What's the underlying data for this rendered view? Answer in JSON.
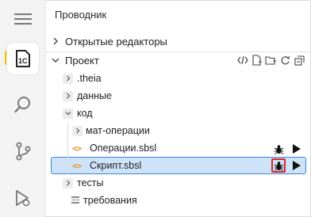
{
  "activity_bar": {
    "items": [
      {
        "icon": "hamburger-menu-icon"
      },
      {
        "icon": "explorer-1c-icon",
        "badge": "1C",
        "active": true
      },
      {
        "icon": "search-icon"
      },
      {
        "icon": "source-control-icon"
      },
      {
        "icon": "run-debug-icon"
      }
    ],
    "accent": "#f2c500"
  },
  "explorer": {
    "title": "Проводник",
    "open_editors_label": "Открытые редакторы",
    "project_label": "Проект",
    "toolbar": [
      "code-icon",
      "new-file-icon",
      "new-folder-icon",
      "refresh-icon",
      "collapse-all-icon"
    ],
    "tree": [
      {
        "label": ".theia",
        "type": "folder",
        "expanded": false
      },
      {
        "label": "данные",
        "type": "folder",
        "expanded": false
      },
      {
        "label": "код",
        "type": "folder",
        "expanded": true
      },
      {
        "label": "мат-операции",
        "type": "folder",
        "expanded": false
      },
      {
        "label": "Операции.sbsl",
        "type": "file",
        "icon": "<>"
      },
      {
        "label": "Скрипт.sbsl",
        "type": "file",
        "icon": "<>",
        "selected": true
      },
      {
        "label": "тесты",
        "type": "folder",
        "expanded": false
      },
      {
        "label": "требования",
        "type": "file"
      }
    ],
    "selection_color": "#cfe3f8",
    "highlight_color": "#d9262f"
  }
}
